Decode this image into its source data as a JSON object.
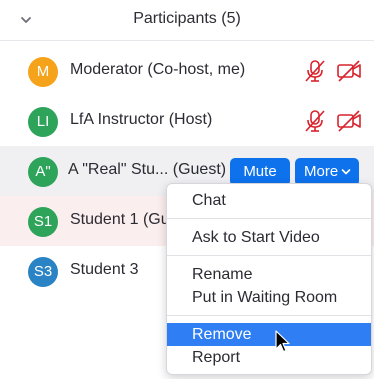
{
  "header": {
    "title": "Participants (5)",
    "collapse_icon": "chevron-down-icon"
  },
  "participants": [
    {
      "initials": "M",
      "name": "Moderator (Co-host, me)",
      "avatar_color": "#f5a31a",
      "mic": "muted",
      "video": "off"
    },
    {
      "initials": "LI",
      "name": "LfA Instructor (Host)",
      "avatar_color": "#2ea35a",
      "mic": "muted",
      "video": "off"
    },
    {
      "initials": "A\"",
      "name": "A \"Real\" Stu... (Guest)",
      "avatar_color": "#2ea35a",
      "mute_label": "Mute",
      "more_label": "More"
    },
    {
      "initials": "S1",
      "name": "Student 1 (Gu",
      "avatar_color": "#2ea35a"
    },
    {
      "initials": "S3",
      "name": "Student 3",
      "avatar_color": "#2a83c4"
    }
  ],
  "menu": {
    "items": [
      "Chat",
      "Ask to Start Video",
      "Rename",
      "Put in Waiting Room",
      "Remove",
      "Report"
    ],
    "active_item": "Remove"
  },
  "colors": {
    "accent": "#0e72ed",
    "muted_red": "#d9232d",
    "menu_highlight": "#2f7ef3"
  }
}
